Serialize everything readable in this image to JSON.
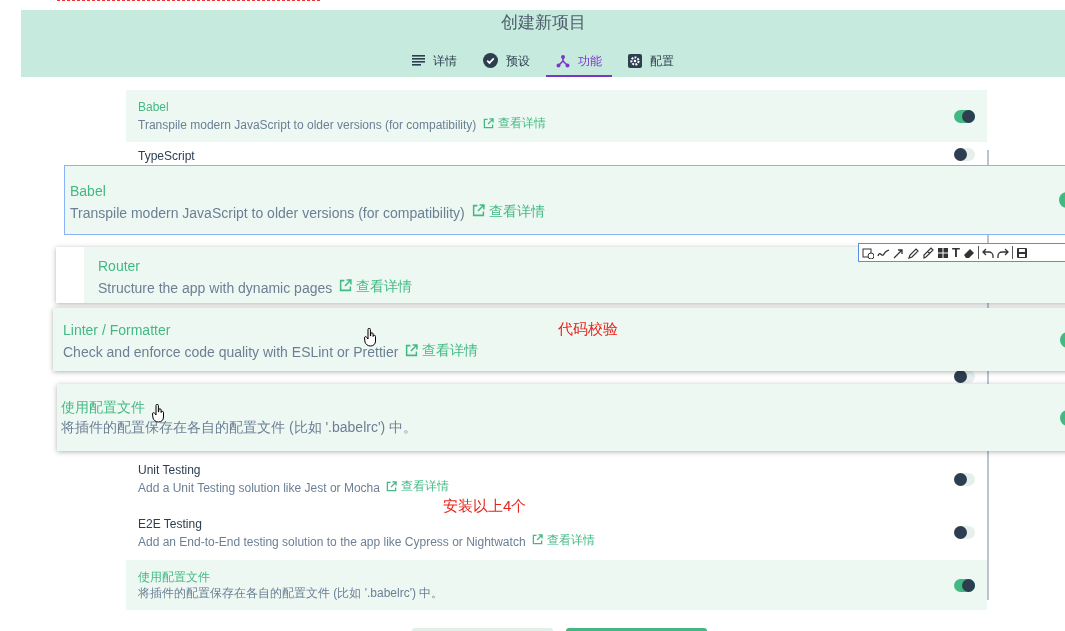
{
  "header": {
    "title": "创建新项目"
  },
  "tabs": [
    {
      "label": "详情",
      "selected": false
    },
    {
      "label": "预设",
      "selected": false
    },
    {
      "label": "功能",
      "selected": true
    },
    {
      "label": "配置",
      "selected": false
    }
  ],
  "features": [
    {
      "kind": "full",
      "title": "Babel",
      "description": "Transpile modern JavaScript to older versions (for compatibility)",
      "link": "查看详情",
      "selected": true,
      "on": true
    },
    {
      "kind": "title",
      "title": "TypeScript",
      "selected": false,
      "on": false
    },
    {
      "kind": "toggle",
      "selected": false,
      "on": false
    },
    {
      "kind": "full",
      "title": "Unit Testing",
      "description": "Add a Unit Testing solution like Jest or Mocha",
      "link": "查看详情",
      "selected": false,
      "on": false
    },
    {
      "kind": "full",
      "title": "E2E Testing",
      "description": "Add an End-to-End testing solution to the app like Cypress or Nightwatch",
      "link": "查看详情",
      "selected": false,
      "on": false
    },
    {
      "kind": "full",
      "title": "使用配置文件",
      "description": "将插件的配置保存在各自的配置文件 (比如 '.babelrc') 中。",
      "selected": true,
      "on": true
    }
  ],
  "overlays": [
    {
      "title": "Babel",
      "description": "Transpile modern JavaScript to older versions (for compatibility)",
      "link": "查看详情",
      "focused": true,
      "on": true
    },
    {
      "title": "Router",
      "description": "Structure the app with dynamic pages",
      "link": "查看详情",
      "focused": false
    },
    {
      "title": "Linter / Formatter",
      "description": "Check and enforce code quality with ESLint or Prettier",
      "link": "查看详情",
      "focused": false,
      "on": true
    },
    {
      "title": "使用配置文件",
      "description": "将插件的配置保存在各自的配置文件 (比如 '.babelrc') 中。",
      "focused": false,
      "on": true
    }
  ],
  "annotations": [
    {
      "text": "代码校验"
    },
    {
      "text": "安装以上4个"
    }
  ],
  "toolbar": {
    "text_tool": "T"
  }
}
